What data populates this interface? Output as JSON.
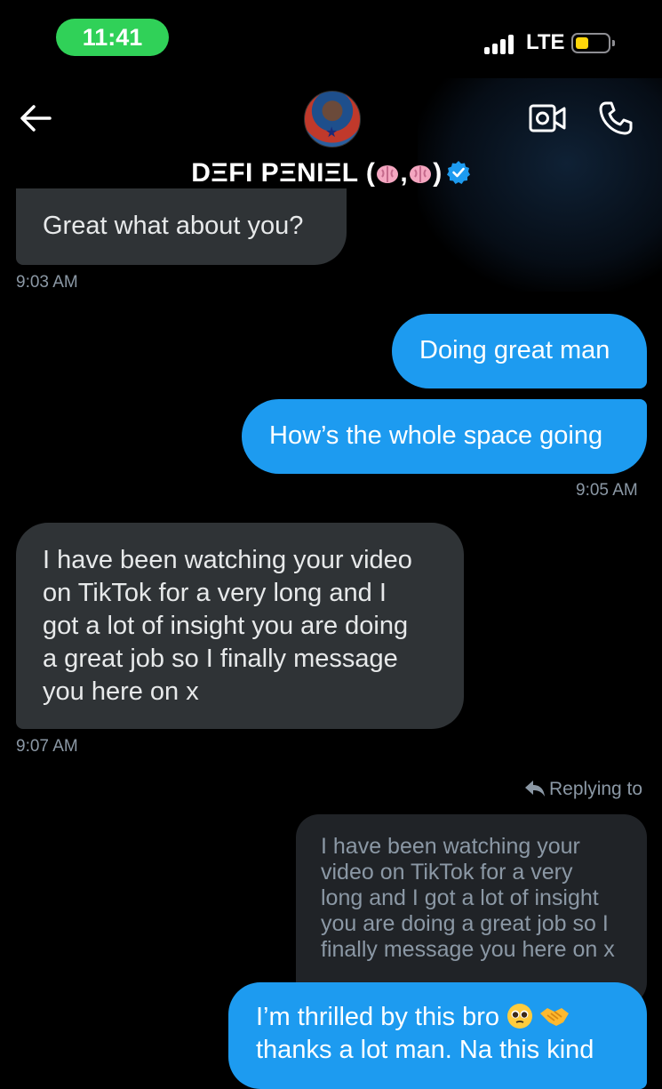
{
  "status_bar": {
    "time": "11:41",
    "network": "LTE",
    "signal_bars": 4,
    "battery_color": "#ffd60a",
    "battery_level_fraction": 0.4
  },
  "header": {
    "contact_name": "DΞFI PΞNIΞL (",
    "name_separator": ",",
    "name_suffix": ")",
    "name_emoji": "brain-emoji",
    "verified": true,
    "accent": "#1d9bf0"
  },
  "messages": [
    {
      "direction": "incoming",
      "lines": [
        "Great what about you?"
      ],
      "time": "9:03 AM"
    },
    {
      "direction": "outgoing",
      "lines": [
        "Doing great man"
      ]
    },
    {
      "direction": "outgoing",
      "lines": [
        "How’s the whole space going"
      ],
      "time": "9:05 AM"
    },
    {
      "direction": "incoming",
      "lines": [
        "I have been watching your video",
        "on TikTok for a very long  and I",
        "got a lot of insight you are doing",
        "a great job so I finally message",
        "you here on x"
      ],
      "time": "9:07 AM"
    },
    {
      "direction": "outgoing",
      "replying_label": "Replying to",
      "quoted_lines": [
        "I have been watching your",
        "video on TikTok for a very",
        "long  and I got a lot of insight",
        "you are doing a great job so I",
        "finally message you here on x"
      ],
      "lines": [
        "I’m thrilled by this bro",
        "thanks a lot man. Na this kind"
      ],
      "emojis": [
        "pleading-face-emoji",
        "handshake-emoji"
      ]
    }
  ],
  "colors": {
    "incoming_bubble": "#2f3336",
    "outgoing_bubble": "#1d9bf0",
    "quoted_bubble": "#202327",
    "timestamp": "#8b98a5",
    "time_pill": "#30d158"
  }
}
